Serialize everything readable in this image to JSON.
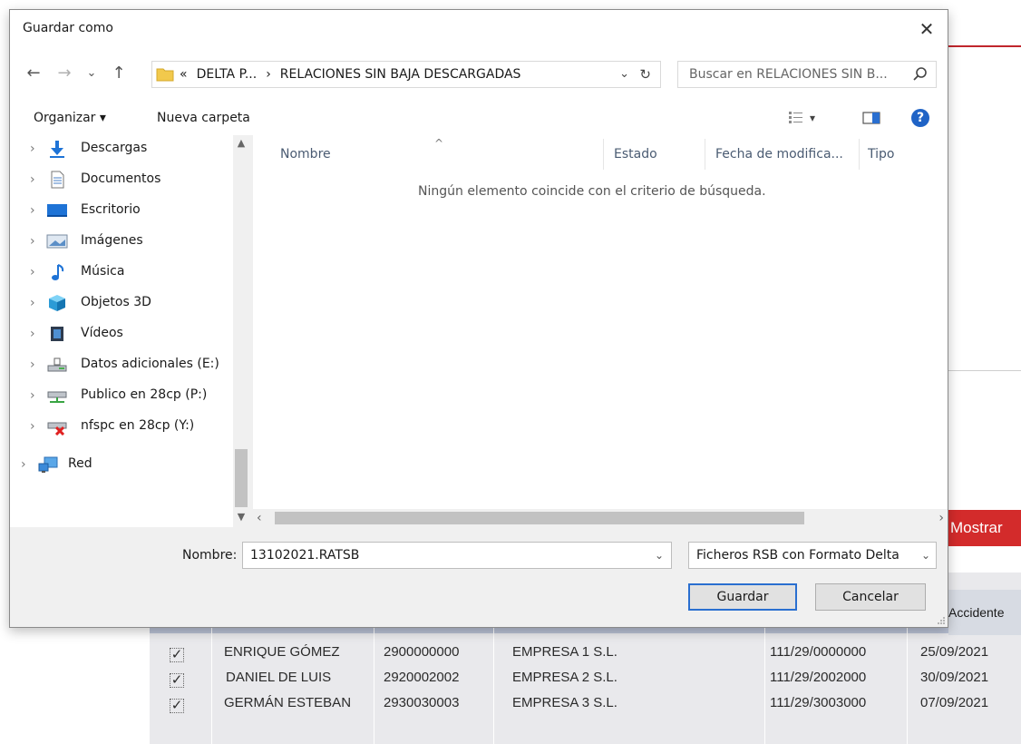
{
  "dialog": {
    "title": "Guardar como",
    "close_glyph": "✕",
    "nav": {
      "back": "←",
      "forward": "→",
      "recent": "⌄",
      "up": "↑"
    },
    "address": {
      "overflow": "«",
      "crumbs": [
        "DELTA P...",
        "›",
        "RELACIONES SIN BAJA DESCARGADAS"
      ],
      "dropdown": "⌄",
      "refresh": "↻"
    },
    "search": {
      "placeholder": "Buscar en RELACIONES SIN B..."
    },
    "toolbar": {
      "organize": "Organizar ▾",
      "new_folder": "Nueva carpeta",
      "view_dropdown": "▾",
      "help": "?"
    },
    "sidebar": {
      "items": [
        {
          "label": "Descargas",
          "icon": "download-icon"
        },
        {
          "label": "Documentos",
          "icon": "document-icon"
        },
        {
          "label": "Escritorio",
          "icon": "desktop-icon"
        },
        {
          "label": "Imágenes",
          "icon": "pictures-icon"
        },
        {
          "label": "Música",
          "icon": "music-icon"
        },
        {
          "label": "Objetos 3D",
          "icon": "cube-icon"
        },
        {
          "label": "Vídeos",
          "icon": "video-icon"
        },
        {
          "label": "Datos adicionales (E:)",
          "icon": "drive-icon"
        },
        {
          "label": "Publico en 28cp (P:)",
          "icon": "network-drive-icon"
        },
        {
          "label": "nfspc en 28cp (Y:)",
          "icon": "disconnected-drive-icon"
        },
        {
          "label": "Red",
          "icon": "network-icon"
        }
      ],
      "chevron": "›"
    },
    "file_list": {
      "columns": [
        "Nombre",
        "Estado",
        "Fecha de modifica...",
        "Tipo"
      ],
      "sort_glyph": "^",
      "empty_message": "Ningún elemento coincide con el criterio de búsqueda."
    },
    "footer": {
      "name_label": "Nombre:",
      "name_value": "13102021.RATSB",
      "type_value": "Ficheros RSB con Formato Delta",
      "save": "Guardar",
      "cancel": "Cancelar"
    }
  },
  "background": {
    "show_button": "Mostrar",
    "accident_header": "Accidente",
    "rows": [
      {
        "check": "✓",
        "name": "ENRIQUE GÓMEZ",
        "id": "2900000000",
        "company": "EMPRESA 1  S.L.",
        "code": "111/29/0000000",
        "date": "25/09/2021"
      },
      {
        "check": "✓",
        "name": "DANIEL DE LUIS",
        "id": "2920002002",
        "company": "EMPRESA 2  S.L.",
        "code": "111/29/2002000",
        "date": "30/09/2021"
      },
      {
        "check": "✓",
        "name": "GERMÁN ESTEBAN",
        "id": "2930030003",
        "company": "EMPRESA 3  S.L.",
        "code": "111/29/3003000",
        "date": "07/09/2021"
      }
    ]
  },
  "colors": {
    "accent_blue": "#2a6fd0",
    "brand_red": "#d32b2b"
  }
}
